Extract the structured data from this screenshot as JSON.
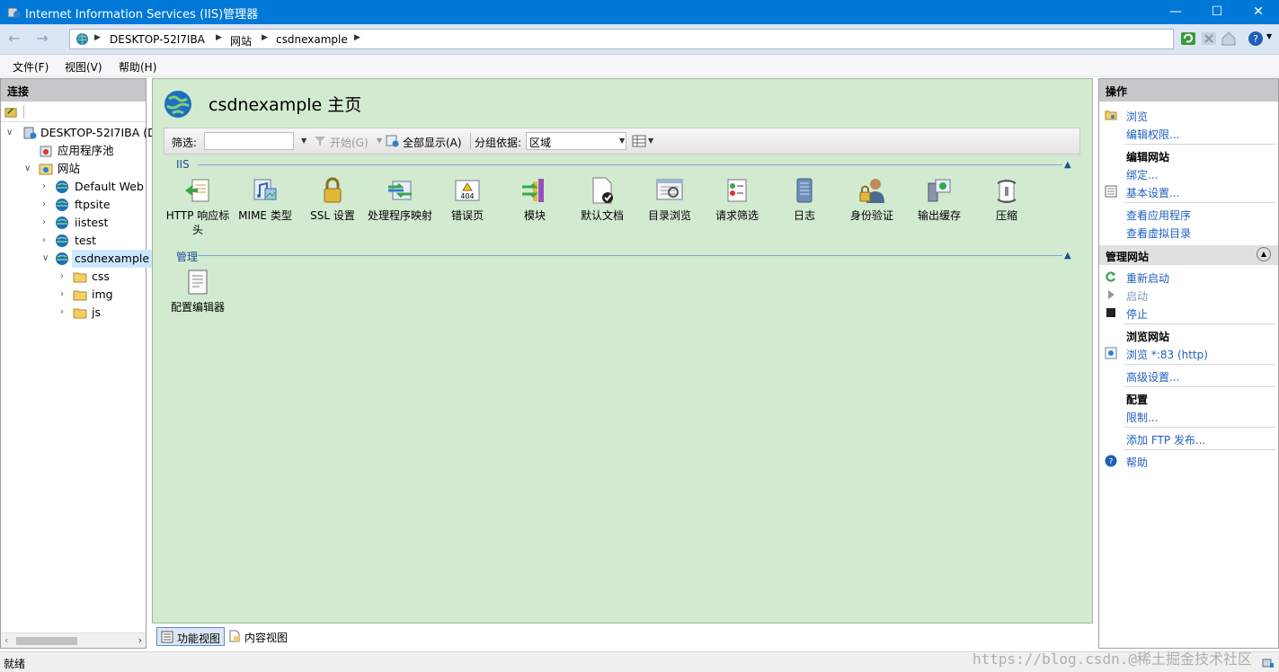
{
  "window": {
    "title": "Internet Information Services (IIS)管理器",
    "minimize": "—",
    "maximize": "☐",
    "close": "✕"
  },
  "address": {
    "crumbs": [
      "DESKTOP-52I7IBA",
      "网站",
      "csdnexample"
    ]
  },
  "menu": [
    "文件(F)",
    "视图(V)",
    "帮助(H)"
  ],
  "connections": {
    "header": "连接",
    "tree": [
      {
        "label": "DESKTOP-52I7IBA (D",
        "icon": "server-icon"
      },
      {
        "label": "应用程序池",
        "icon": "app-pool-icon"
      },
      {
        "label": "网站",
        "icon": "sites-folder-icon"
      },
      {
        "label": "Default Web S",
        "icon": "globe-icon"
      },
      {
        "label": "ftpsite",
        "icon": "globe-icon"
      },
      {
        "label": "iistest",
        "icon": "globe-icon"
      },
      {
        "label": "test",
        "icon": "globe-icon"
      },
      {
        "label": "csdnexample",
        "icon": "globe-icon"
      },
      {
        "label": "css",
        "icon": "folder-icon"
      },
      {
        "label": "img",
        "icon": "folder-icon"
      },
      {
        "label": "js",
        "icon": "folder-icon"
      }
    ]
  },
  "center": {
    "title": "csdnexample 主页",
    "filter": {
      "label": "筛选:",
      "value": "",
      "start": "开始(G)",
      "show_all": "全部显示(A)",
      "group_label": "分组依据:",
      "group_value": "区域"
    },
    "groups": [
      {
        "name": "IIS",
        "features": [
          {
            "label": "HTTP 响应标头",
            "icon": "http-headers-icon"
          },
          {
            "label": "MIME 类型",
            "icon": "mime-types-icon"
          },
          {
            "label": "SSL 设置",
            "icon": "ssl-lock-icon"
          },
          {
            "label": "处理程序映射",
            "icon": "handler-mappings-icon"
          },
          {
            "label": "错误页",
            "icon": "error-pages-icon"
          },
          {
            "label": "模块",
            "icon": "modules-icon"
          },
          {
            "label": "默认文档",
            "icon": "default-document-icon"
          },
          {
            "label": "目录浏览",
            "icon": "directory-browsing-icon"
          },
          {
            "label": "请求筛选",
            "icon": "request-filtering-icon"
          },
          {
            "label": "日志",
            "icon": "logging-icon"
          },
          {
            "label": "身份验证",
            "icon": "authentication-icon"
          },
          {
            "label": "输出缓存",
            "icon": "output-caching-icon"
          },
          {
            "label": "压缩",
            "icon": "compression-icon"
          }
        ]
      },
      {
        "name": "管理",
        "features": [
          {
            "label": "配置编辑器",
            "icon": "configuration-editor-icon"
          }
        ]
      }
    ],
    "error_page_badge": "404"
  },
  "view_tabs": [
    "功能视图",
    "内容视图"
  ],
  "actions": {
    "header": "操作",
    "browse": "浏览",
    "edit_permissions": "编辑权限...",
    "edit_site_head": "编辑网站",
    "bindings": "绑定...",
    "basic_settings": "基本设置...",
    "view_apps": "查看应用程序",
    "view_vdirs": "查看虚拟目录",
    "manage_site_head": "管理网站",
    "restart": "重新启动",
    "start": "启动",
    "stop": "停止",
    "browse_site_head": "浏览网站",
    "browse_83": "浏览 *:83 (http)",
    "advanced_settings": "高级设置...",
    "config_head": "配置",
    "limits": "限制...",
    "add_ftp": "添加 FTP 发布...",
    "help": "帮助"
  },
  "status": {
    "text": "就绪"
  },
  "watermark": "https://blog.csdn.@稀土掘金技术社区",
  "colors": {
    "titlebar": "#0078d7",
    "content_bg": "#d2ead0",
    "link": "#1f5fbf"
  }
}
